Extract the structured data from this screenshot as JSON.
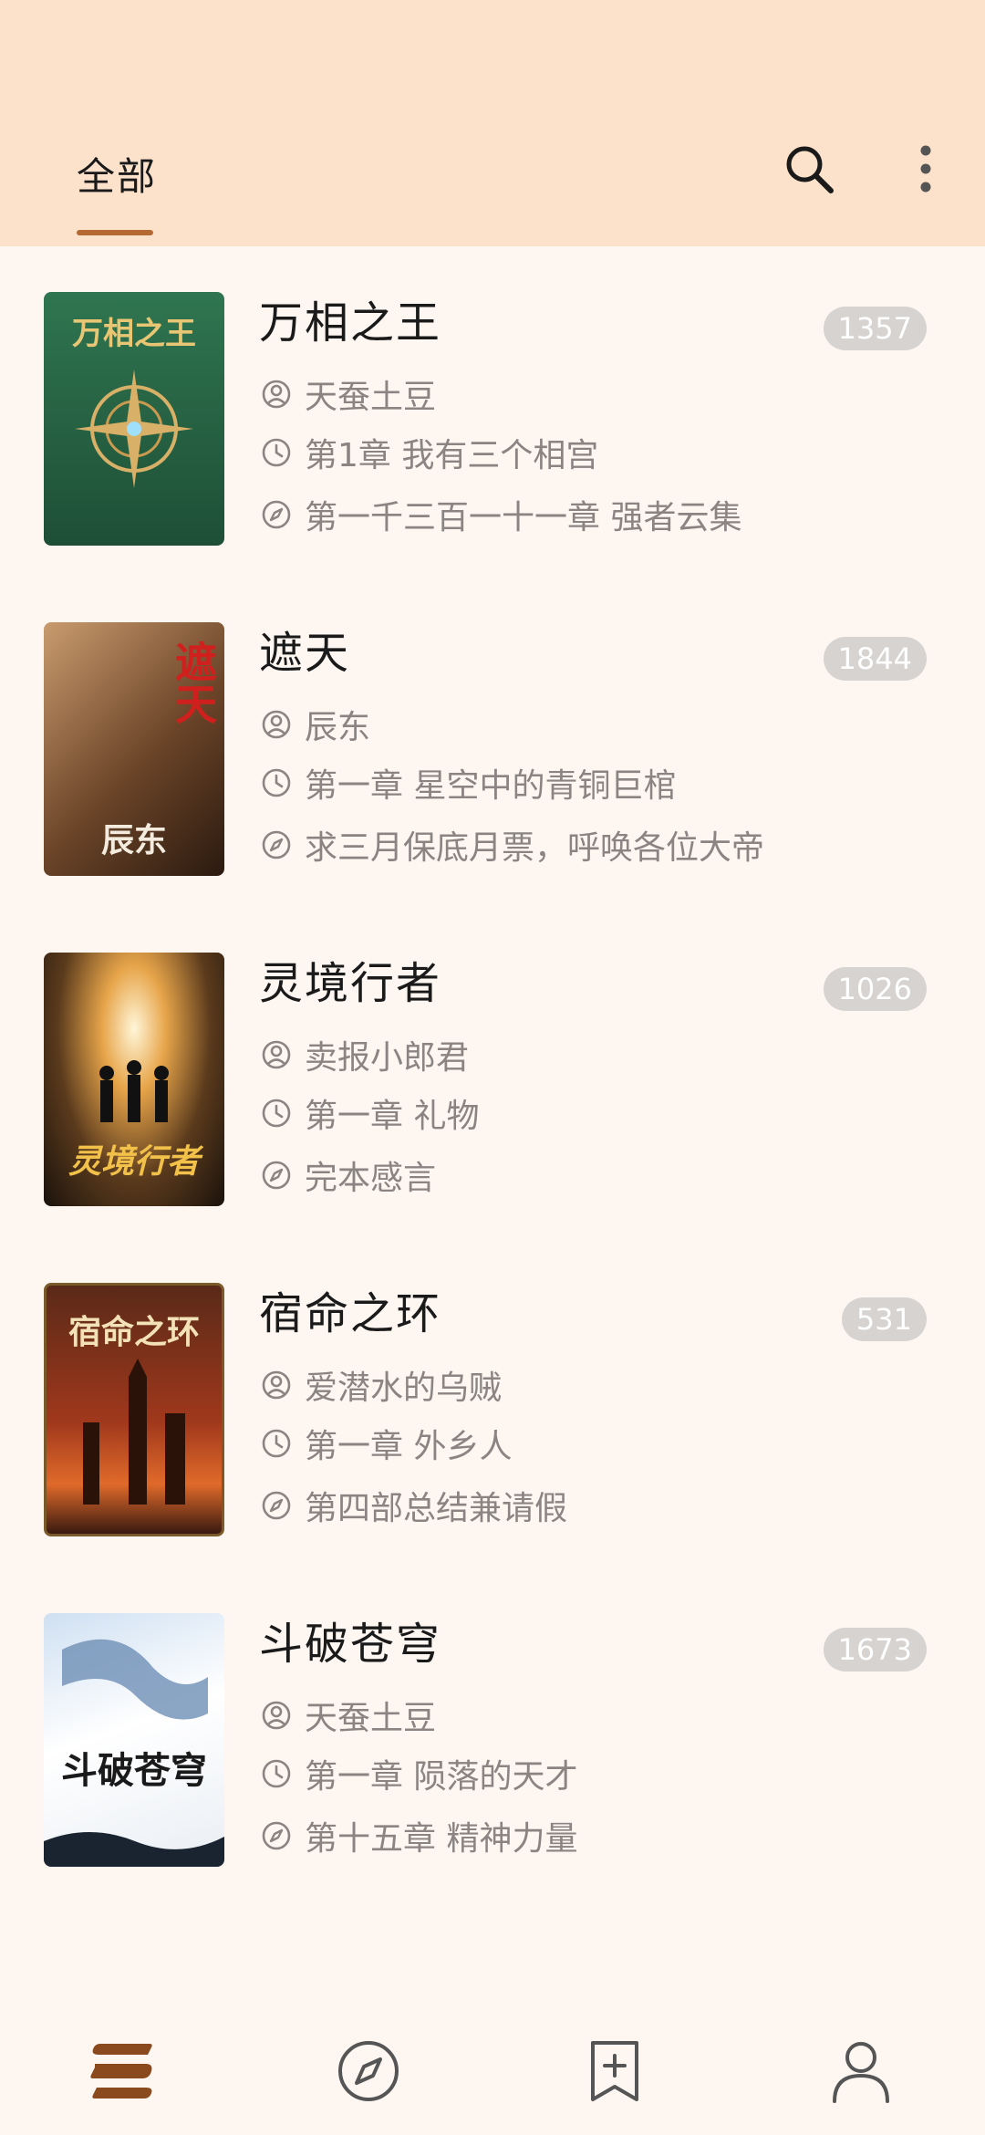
{
  "header": {
    "tab_label": "全部",
    "search_icon": "search-icon",
    "more_icon": "more-vertical-icon"
  },
  "books": [
    {
      "title": "万相之王",
      "count": "1357",
      "author": "天蚕土豆",
      "first_chapter": "第1章 我有三个相宫",
      "latest_chapter": "第一千三百一十一章 强者云集",
      "cover_text": "万相之王",
      "cover_color": "#2e6a4a"
    },
    {
      "title": "遮天",
      "count": "1844",
      "author": "辰东",
      "first_chapter": "第一章 星空中的青铜巨棺",
      "latest_chapter": "求三月保底月票，呼唤各位大帝",
      "cover_text": "遮天",
      "cover_sub": "辰东",
      "cover_color": "#6d4a2c"
    },
    {
      "title": "灵境行者",
      "count": "1026",
      "author": "卖报小郎君",
      "first_chapter": "第一章 礼物",
      "latest_chapter": "完本感言",
      "cover_text": "灵境行者",
      "cover_color": "#2a1e14"
    },
    {
      "title": "宿命之环",
      "count": "531",
      "author": "爱潜水的乌贼",
      "first_chapter": "第一章 外乡人",
      "latest_chapter": "第四部总结兼请假",
      "cover_text": "宿命之环",
      "cover_color": "#7a2a14"
    },
    {
      "title": "斗破苍穹",
      "count": "1673",
      "author": "天蚕土豆",
      "first_chapter": "第一章 陨落的天才",
      "latest_chapter": "第十五章 精神力量",
      "cover_text": "斗破苍穹",
      "cover_color": "#e9eef4"
    }
  ],
  "bottom_nav": [
    {
      "icon": "bookshelf-icon",
      "active": true
    },
    {
      "icon": "compass-icon",
      "active": false
    },
    {
      "icon": "bookmark-add-icon",
      "active": false
    },
    {
      "icon": "user-icon",
      "active": false
    }
  ],
  "colors": {
    "accent": "#b46a32",
    "header_bg": "#fde2cb",
    "page_bg": "#fdf6f1",
    "meta_text": "#8a8583",
    "badge_bg": "#d6d3d1"
  }
}
